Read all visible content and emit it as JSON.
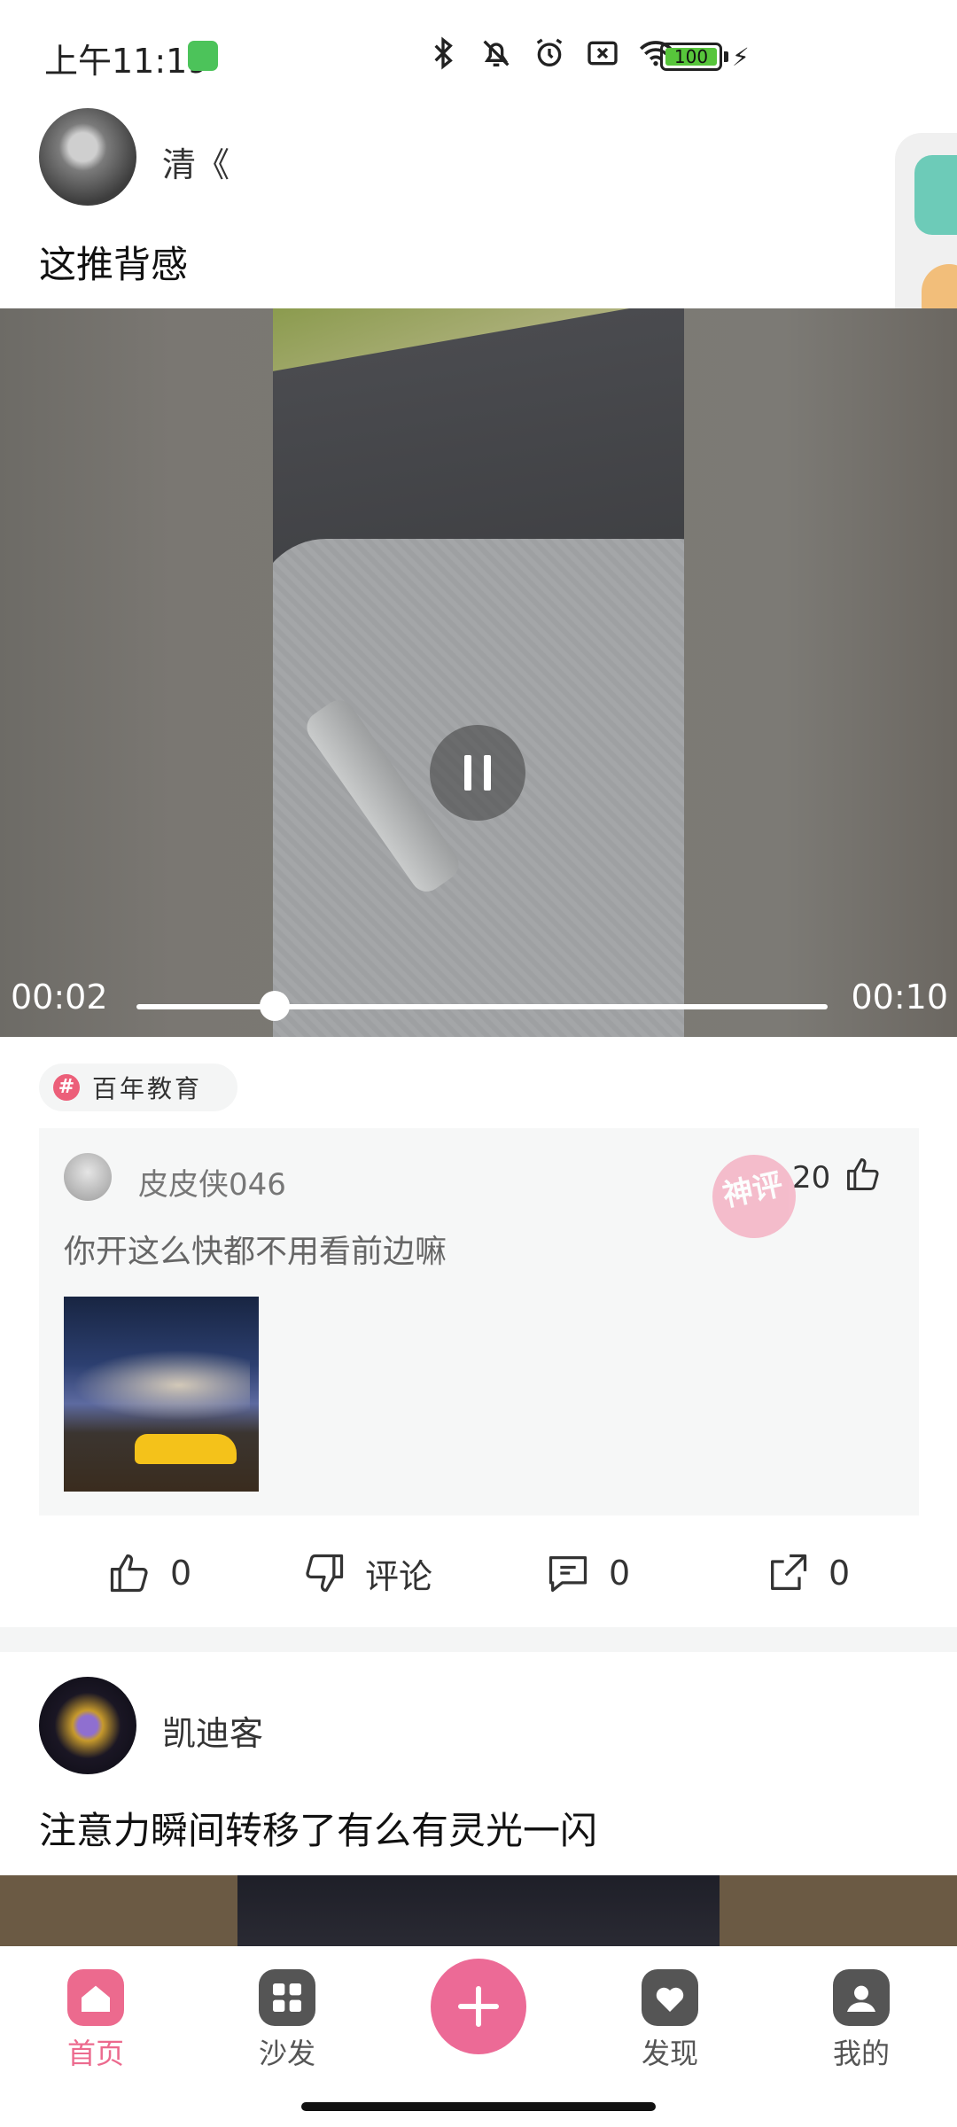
{
  "status_bar": {
    "time": "上午11:19",
    "battery": "100",
    "icons": [
      "bluetooth-icon",
      "bell-off-icon",
      "alarm-icon",
      "sim-off-icon",
      "wifi-icon",
      "battery-icon",
      "charging-icon"
    ]
  },
  "post1": {
    "username": "清《",
    "text": "这推背感",
    "video": {
      "current_time": "00:02",
      "duration": "00:10",
      "progress": 0.2
    },
    "topic": "百年教育",
    "topic_icon": "#",
    "hot_comment": {
      "username": "皮皮侠046",
      "badge": "神评",
      "likes": "20",
      "text": "你开这么快都不用看前边嘛"
    },
    "actions": {
      "like_count": "0",
      "dislike_label": "评论",
      "comment_count": "0",
      "share_count": "0"
    }
  },
  "post2": {
    "username": "凯迪客",
    "text": "注意力瞬间转移了有么有灵光一闪"
  },
  "tab_bar": {
    "items": [
      {
        "label": "首页",
        "icon": "home-icon",
        "active": true
      },
      {
        "label": "沙发",
        "icon": "grid-icon",
        "active": false
      },
      {
        "label": "发现",
        "icon": "heart-icon",
        "active": false
      },
      {
        "label": "我的",
        "icon": "user-icon",
        "active": false
      }
    ],
    "publish_icon": "plus-icon"
  },
  "colors": {
    "accent": "#ec6a8e",
    "topic_icon": "#ec5f79",
    "battery": "#57c53b"
  }
}
